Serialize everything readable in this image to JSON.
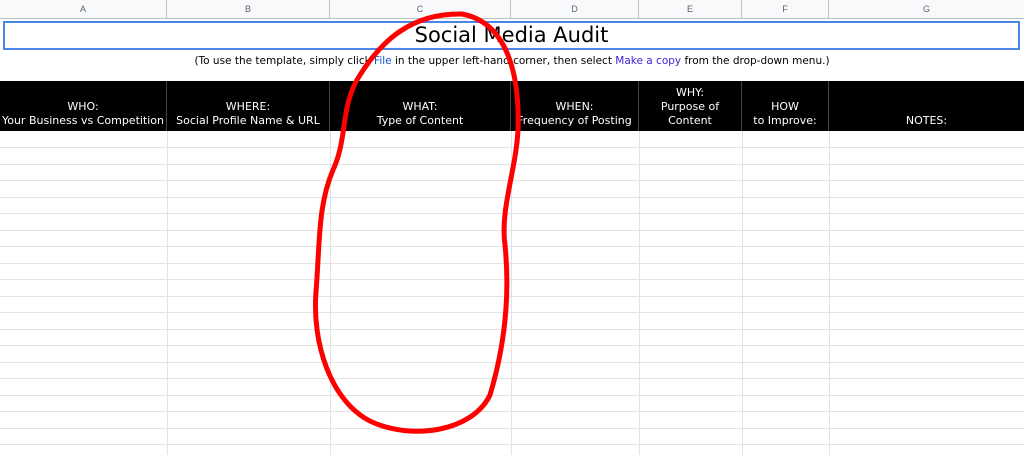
{
  "columns": [
    "A",
    "B",
    "C",
    "D",
    "E",
    "F",
    "G"
  ],
  "title": "Social Media Audit",
  "instructions": {
    "before_file": "(To use the template, simply click ",
    "file_link": "File",
    "middle": " in the upper left-hand corner, then select ",
    "copy_link": "Make a copy",
    "after": " from the drop-down menu.)"
  },
  "headers": [
    {
      "line1": "WHO:",
      "line2": "Your Business vs Competition"
    },
    {
      "line1": "WHERE:",
      "line2": "Social Profile Name & URL"
    },
    {
      "line1": "WHAT:",
      "line2": "Type of Content"
    },
    {
      "line1": "WHEN:",
      "line2": "Frequency of Posting"
    },
    {
      "line0": "WHY:",
      "line1": "Purpose of",
      "line2": "Content"
    },
    {
      "line1": "HOW",
      "line2": "to Improve:"
    },
    {
      "line1": "",
      "line2": "NOTES:"
    }
  ],
  "colors": {
    "header_bg": "#000000",
    "header_text": "#ffffff",
    "selection_border": "#4a86e8",
    "annotation_stroke": "#ff0000"
  }
}
